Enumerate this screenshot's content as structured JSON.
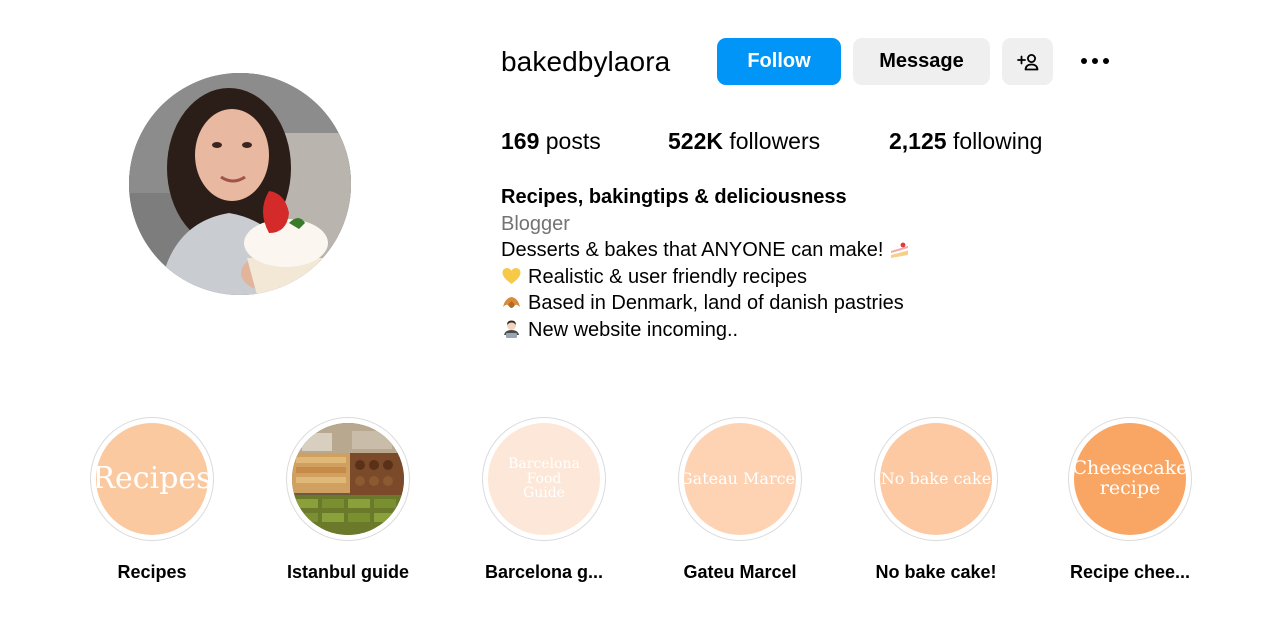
{
  "profile": {
    "username": "bakedbylaora",
    "follow_label": "Follow",
    "message_label": "Message",
    "suggest_icon": "add-person-icon",
    "more_icon": "more-options-icon"
  },
  "stats": {
    "posts_count": "169",
    "posts_label": "posts",
    "followers_count": "522K",
    "followers_label": "followers",
    "following_count": "2,125",
    "following_label": "following"
  },
  "bio": {
    "name": "Recipes, bakingtips & deliciousness",
    "category": "Blogger",
    "line1": "Desserts & bakes that ANYONE can make!",
    "line1_emoji": "shortcake-emoji",
    "line2": "Realistic & user friendly recipes",
    "line2_emoji": "yellow-heart-emoji",
    "line3": "Based in Denmark, land of danish pastries",
    "line3_emoji": "croissant-emoji",
    "line4": "New website incoming..",
    "line4_emoji": "technologist-emoji"
  },
  "highlights": [
    {
      "label": "Recipes",
      "cover_text": "Recipes",
      "cover_color": "#fbc9a0"
    },
    {
      "label": "Istanbul guide",
      "cover_text": "",
      "cover_color": "#8a7a5a"
    },
    {
      "label": "Barcelona g...",
      "cover_text": "Barcelona Food Guide",
      "cover_color": "#fde6d6"
    },
    {
      "label": "Gateu Marcel",
      "cover_text": "Gateau Marcel",
      "cover_color": "#fdd3b4"
    },
    {
      "label": "No bake cake!",
      "cover_text": "No bake cake",
      "cover_color": "#fcc9a2"
    },
    {
      "label": "Recipe chee...",
      "cover_text": "Cheesecake recipe",
      "cover_color": "#f9a665"
    }
  ],
  "colors": {
    "follow_bg": "#0095f6",
    "secondary_btn_bg": "#efefef",
    "category_text": "#737373",
    "ring_border": "#dbdbdb"
  }
}
